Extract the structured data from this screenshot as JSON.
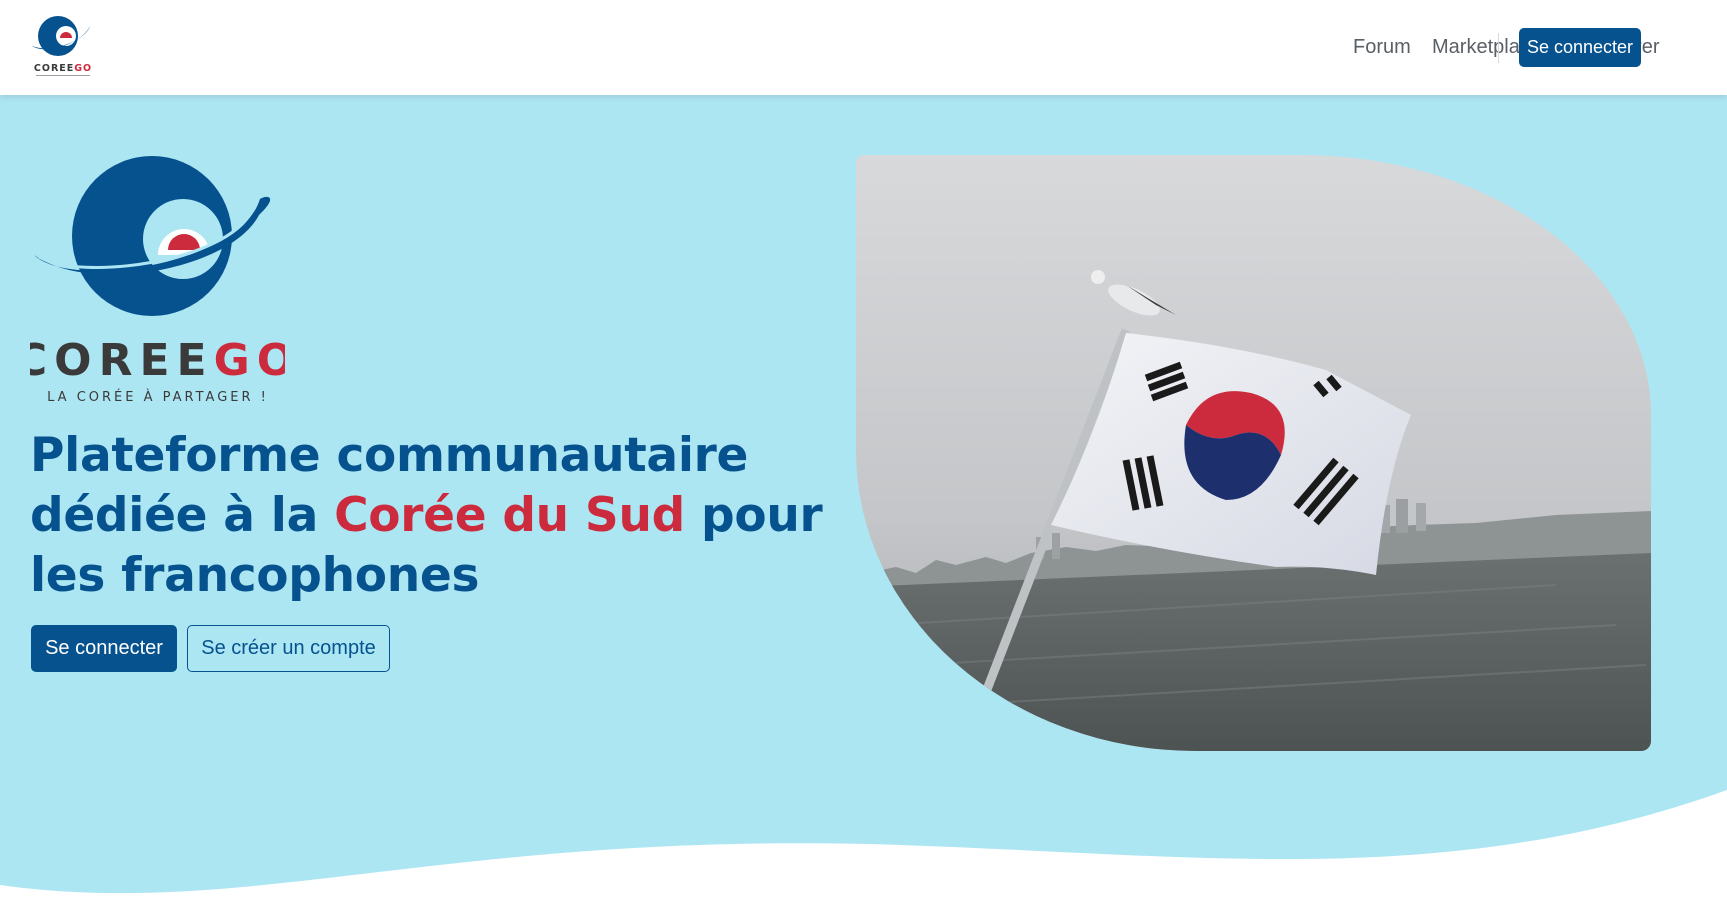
{
  "brand": {
    "name_part1": "COREE",
    "name_part2": "GO",
    "tagline": "LA CORÉE À PARTAGER !"
  },
  "nav": {
    "links": [
      "Forum",
      "Marketplace",
      "Explorer"
    ],
    "login_label": "Se connecter"
  },
  "hero": {
    "title_part1": "Plateforme communautaire dédiée à la ",
    "title_highlight": "Corée du Sud",
    "title_part2": " pour les francophones",
    "login_label": "Se connecter",
    "signup_label": "Se créer un compte"
  },
  "colors": {
    "primary": "#05528f",
    "accent": "#cc2a3d",
    "hero_background": "#ade6f3",
    "logo_dark": "#3a3a3a"
  }
}
